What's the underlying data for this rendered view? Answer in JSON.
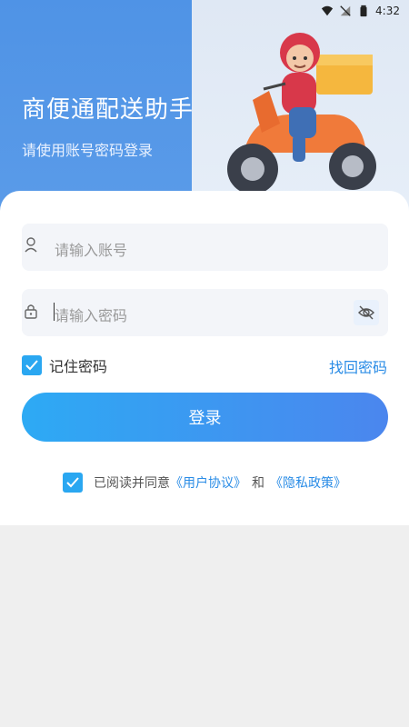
{
  "status_bar": {
    "time": "4:32"
  },
  "hero": {
    "title": "商便通配送助手",
    "subtitle": "请使用账号密码登录"
  },
  "form": {
    "account_placeholder": "请输入账号",
    "password_placeholder": "请输入密码",
    "remember_label": "记住密码",
    "forgot_label": "找回密码",
    "login_label": "登录"
  },
  "agreement": {
    "prefix": "已阅读并同意",
    "user_agreement": "《用户协议》",
    "and": "和",
    "privacy_policy": "《隐私政策》"
  },
  "colors": {
    "primary": "#2aa7f1",
    "link": "#2a8ce6",
    "hero_blue": "#4f93e6"
  }
}
